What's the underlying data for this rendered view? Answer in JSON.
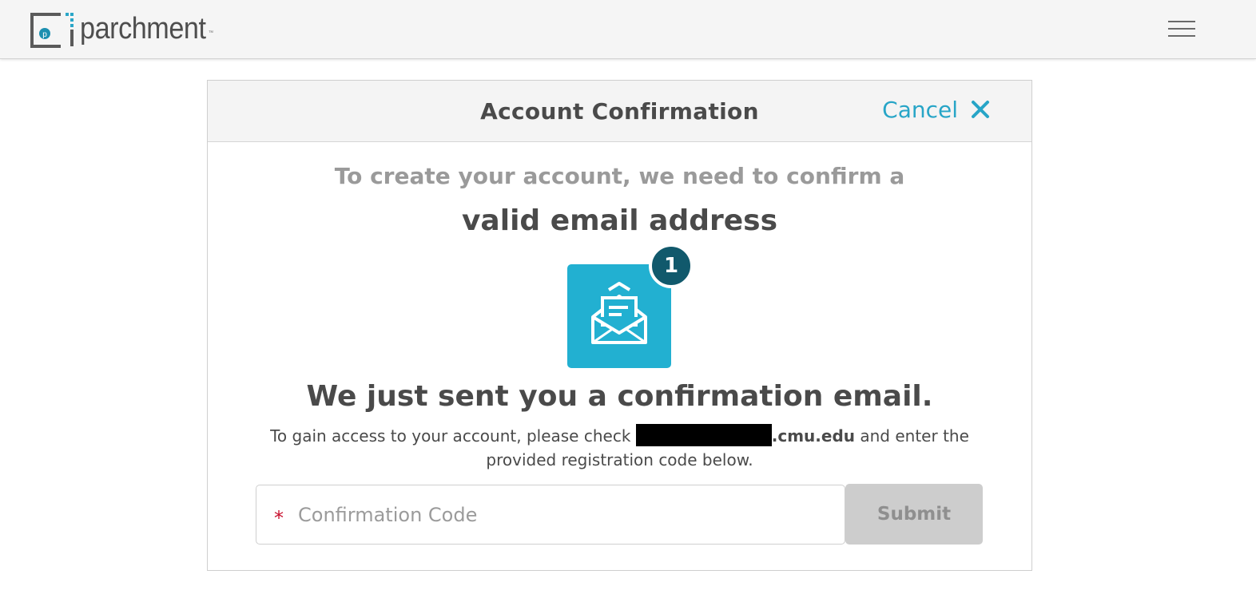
{
  "brand": {
    "name": "parchment",
    "tm": "™",
    "logo_letter": "p",
    "colors": {
      "accent": "#27a5c7",
      "envelope_bg": "#22b0d1",
      "badge_bg": "#11596c",
      "required": "#c8102e"
    }
  },
  "topbar": {
    "menu_icon": "hamburger-menu-icon"
  },
  "dialog": {
    "title": "Account Confirmation",
    "cancel_label": "Cancel",
    "cancel_icon": "close-icon",
    "intro_line": "To create your account, we need to confirm a",
    "intro_emphasis": "valid email address",
    "envelope_icon": "open-envelope-icon",
    "badge_count": "1",
    "sent_heading": "We just sent you a confirmation email.",
    "instructions_before": "To gain access to your account, please check ",
    "email_domain": ".cmu.edu",
    "instructions_after": " and enter the provided registration code below.",
    "form": {
      "required_marker": "*",
      "code_placeholder": "Confirmation Code",
      "code_value": "",
      "submit_label": "Submit"
    }
  }
}
